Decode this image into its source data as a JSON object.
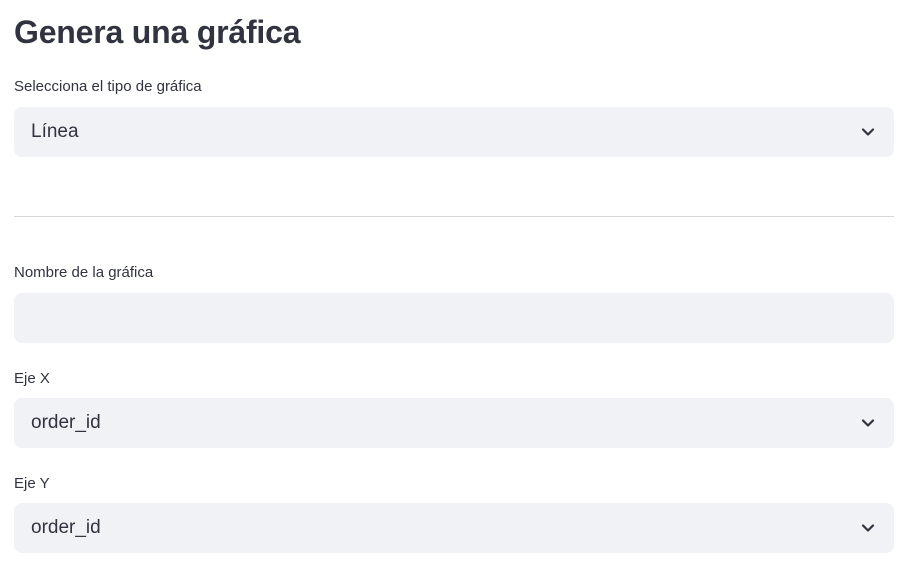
{
  "page": {
    "title": "Genera una gráfica"
  },
  "chart_type": {
    "label": "Selecciona el tipo de gráfica",
    "value": "Línea"
  },
  "chart_name": {
    "label": "Nombre de la gráfica",
    "value": "",
    "placeholder": ""
  },
  "x_axis": {
    "label": "Eje X",
    "value": "order_id"
  },
  "y_axis": {
    "label": "Eje Y",
    "value": "order_id"
  },
  "icons": {
    "select_chevron": "chevron-down-icon"
  },
  "colors": {
    "text": "#31333f",
    "input_background": "#f0f2f6",
    "divider": "#d6d6d9",
    "page_background": "#ffffff"
  }
}
